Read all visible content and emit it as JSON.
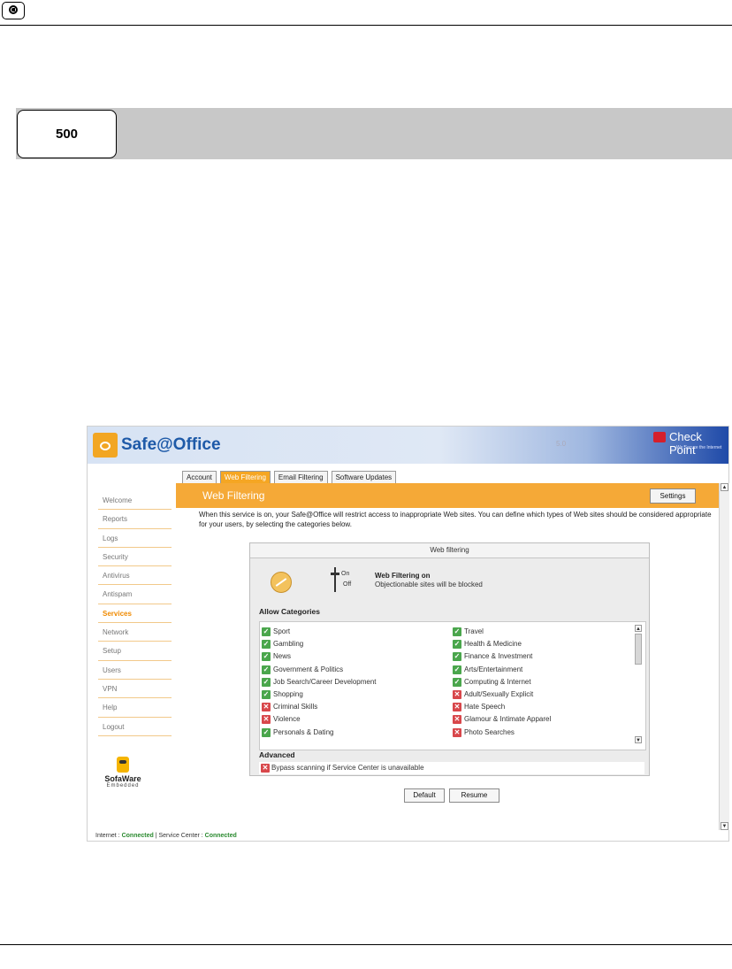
{
  "page": {
    "badge_number": "500"
  },
  "app": {
    "title": "Safe@Office",
    "version": "5.0",
    "brand_top_right": "Check Point",
    "brand_tagline": "We Secure the Internet",
    "tabs": [
      {
        "label": "Account"
      },
      {
        "label": "Web Filtering"
      },
      {
        "label": "Email Filtering"
      },
      {
        "label": "Software Updates"
      }
    ],
    "sidebar": [
      {
        "label": "Welcome"
      },
      {
        "label": "Reports"
      },
      {
        "label": "Logs"
      },
      {
        "label": "Security"
      },
      {
        "label": "Antivirus"
      },
      {
        "label": "Antispam"
      },
      {
        "label": "Services"
      },
      {
        "label": "Network"
      },
      {
        "label": "Setup"
      },
      {
        "label": "Users"
      },
      {
        "label": "VPN"
      },
      {
        "label": "Help"
      },
      {
        "label": "Logout"
      }
    ],
    "footer_brand": {
      "name": "SofaWare",
      "sub": "Embedded"
    },
    "content": {
      "title": "Web Filtering",
      "settings_label": "Settings",
      "description": "When this service is on, your Safe@Office will restrict access to inappropriate Web sites. You can define which types of Web sites should be considered appropriate for your users, by selecting the categories below."
    },
    "panel": {
      "header": "Web filtering",
      "toggle_on": "On",
      "toggle_off": "Off",
      "status_title": "Web Filtering on",
      "status_sub": "Objectionable sites will be blocked",
      "allow_label": "Allow Categories",
      "left_categories": [
        {
          "label": "Sport",
          "allowed": true
        },
        {
          "label": "Gambling",
          "allowed": true
        },
        {
          "label": "News",
          "allowed": true
        },
        {
          "label": "Government & Politics",
          "allowed": true
        },
        {
          "label": "Job Search/Career Development",
          "allowed": true
        },
        {
          "label": "Shopping",
          "allowed": true
        },
        {
          "label": "Criminal Skills",
          "allowed": false
        },
        {
          "label": "Violence",
          "allowed": false
        },
        {
          "label": "Personals & Dating",
          "allowed": true
        }
      ],
      "right_categories": [
        {
          "label": "Travel",
          "allowed": true
        },
        {
          "label": "Health & Medicine",
          "allowed": true
        },
        {
          "label": "Finance & Investment",
          "allowed": true
        },
        {
          "label": "Arts/Entertainment",
          "allowed": true
        },
        {
          "label": "Computing & Internet",
          "allowed": true
        },
        {
          "label": "Adult/Sexually Explicit",
          "allowed": false
        },
        {
          "label": "Hate Speech",
          "allowed": false
        },
        {
          "label": "Glamour & Intimate Apparel",
          "allowed": false
        },
        {
          "label": "Photo Searches",
          "allowed": false
        }
      ],
      "advanced_label": "Advanced",
      "advanced_option": "Bypass scanning if Service Center is unavailable"
    },
    "buttons": {
      "default": "Default",
      "resume": "Resume"
    },
    "status": {
      "internet_label": "Internet :",
      "internet_value": "Connected",
      "separator": "|",
      "service_label": "Service Center :",
      "service_value": "Connected"
    }
  }
}
